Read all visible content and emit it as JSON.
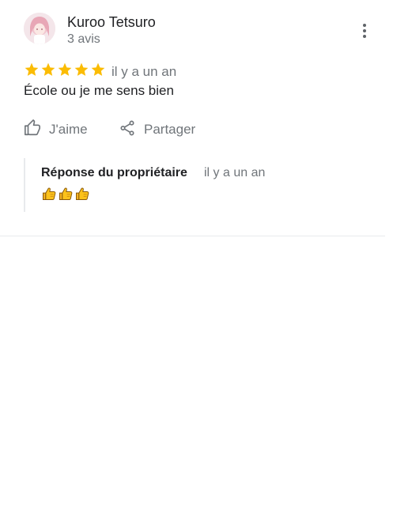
{
  "review": {
    "author_name": "Kuroo Tetsuro",
    "author_review_count": "3 avis",
    "rating": 5,
    "rating_max": 5,
    "time": "il y a un an",
    "text": "École ou je me sens bien",
    "star_color": "#fbbc04"
  },
  "actions": {
    "like_label": "J'aime",
    "share_label": "Partager"
  },
  "owner_reply": {
    "title": "Réponse du propriétaire",
    "time": "il y a un an",
    "emojis": [
      "thumbs-up",
      "thumbs-up",
      "thumbs-up"
    ]
  }
}
